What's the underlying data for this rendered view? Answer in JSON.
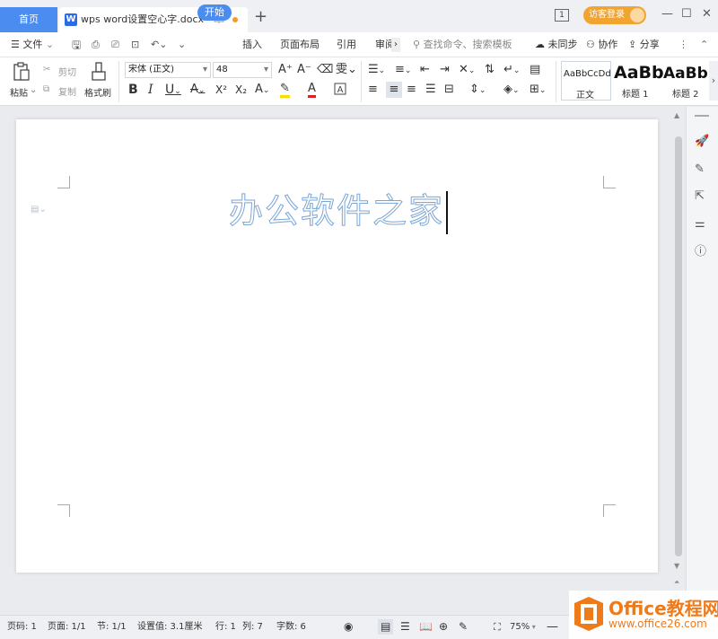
{
  "titlebar": {
    "home_tab": "首页",
    "doc_tab": "wps word设置空心字.docx",
    "badge": "1",
    "login": "访客登录"
  },
  "menu": {
    "file": "文件",
    "tabs": [
      "开始",
      "插入",
      "页面布局",
      "引用",
      "审阅"
    ],
    "search_placeholder": "查找命令、搜索模板",
    "sync": "未同步",
    "collab": "协作",
    "share": "分享"
  },
  "ribbon": {
    "paste": "粘贴",
    "cut": "剪切",
    "copy": "复制",
    "format_painter": "格式刷",
    "font_name": "宋体 (正文)",
    "font_size": "48",
    "styles": [
      {
        "preview": "AaBbCcDd",
        "label": "正文"
      },
      {
        "preview": "AaBb",
        "label": "标题 1"
      },
      {
        "preview": "AaBb(",
        "label": "标题 2"
      }
    ]
  },
  "document": {
    "heading": "办公软件之家"
  },
  "statusbar": {
    "page_code": "页码: 1",
    "pages": "页面: 1/1",
    "section": "节: 1/1",
    "setting": "设置值: 3.1厘米",
    "row": "行: 1",
    "col": "列: 7",
    "words": "字数: 6",
    "zoom": "75%"
  },
  "watermark": {
    "title": "Office教程网",
    "url": "www.office26.com"
  },
  "colors": {
    "accent": "#4a8cf0",
    "login_bg": "#f2a431",
    "hollow_stroke": "#7aa6d6",
    "watermark": "#ef7a1a"
  }
}
